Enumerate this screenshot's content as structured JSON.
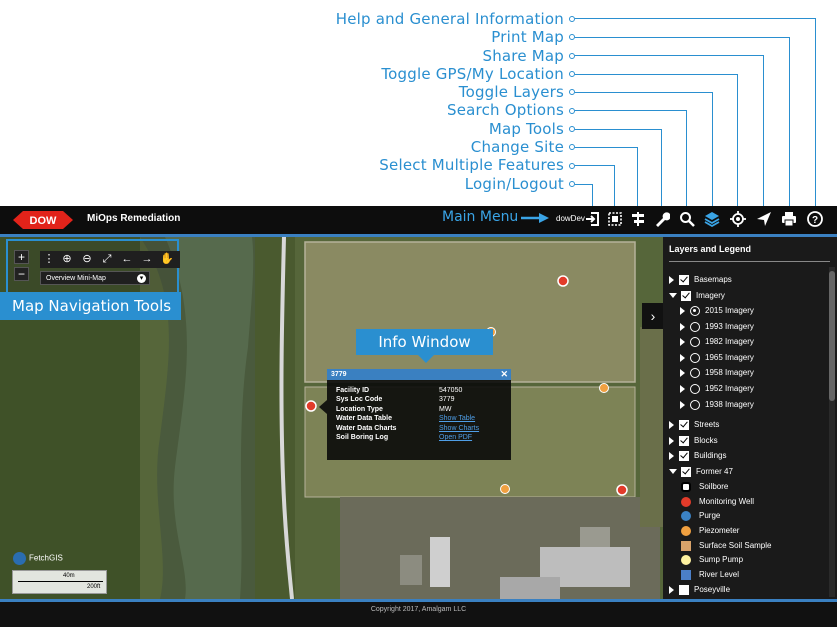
{
  "callouts": [
    {
      "label": "Help and General Information"
    },
    {
      "label": "Print Map"
    },
    {
      "label": "Share Map"
    },
    {
      "label": "Toggle GPS/My Location"
    },
    {
      "label": "Toggle Layers"
    },
    {
      "label": "Search Options"
    },
    {
      "label": "Map Tools"
    },
    {
      "label": "Change Site"
    },
    {
      "label": "Select Multiple Features"
    },
    {
      "label": "Login/Logout"
    }
  ],
  "header": {
    "logo_text": "DOW",
    "app_title": "MiOps Remediation",
    "main_menu_label": "Main Menu",
    "user": "dowDev",
    "tools": [
      "login-icon",
      "select-multiple-icon",
      "change-site-icon",
      "map-tools-icon",
      "search-icon",
      "layers-icon",
      "gps-icon",
      "share-icon",
      "print-icon",
      "help-icon"
    ]
  },
  "nav_tools": {
    "label": "Map Navigation Tools",
    "zoom_in": "+",
    "zoom_out": "−",
    "minimap_label": "Overview Mini-Map"
  },
  "info_window": {
    "label": "Info Window",
    "title": "3779",
    "rows": [
      {
        "key": "Facility ID",
        "value": "547050"
      },
      {
        "key": "Sys Loc Code",
        "value": "3779"
      },
      {
        "key": "Location Type",
        "value": "MW"
      },
      {
        "key": "Water Data Table",
        "value": "Show Table"
      },
      {
        "key": "Water Data Charts",
        "value": "Show Charts"
      },
      {
        "key": "Soil Boring Log",
        "value": "Open PDF"
      }
    ]
  },
  "map": {
    "attribution": "FetchGIS",
    "scale_top": "40m",
    "scale_bottom": "200ft"
  },
  "layers_panel": {
    "title": "Layers and Legend",
    "basemaps": "Basemaps",
    "imagery": "Imagery",
    "imagery_years": [
      "2015 Imagery",
      "1993 Imagery",
      "1982 Imagery",
      "1965 Imagery",
      "1958 Imagery",
      "1952 Imagery",
      "1938 Imagery"
    ],
    "streets": "Streets",
    "blocks": "Blocks",
    "buildings": "Buildings",
    "former": "Former 47",
    "legend": [
      {
        "label": "Soilbore",
        "color": "#ffffff"
      },
      {
        "label": "Monitoring Well",
        "color": "#e23b2a"
      },
      {
        "label": "Purge",
        "color": "#3b82c4"
      },
      {
        "label": "Piezometer",
        "color": "#f0a040"
      },
      {
        "label": "Surface Soil Sample",
        "color": "#d9a36a"
      },
      {
        "label": "Sump Pump",
        "color": "#fff2a0"
      },
      {
        "label": "River Level",
        "color": "#4b7fc7"
      }
    ],
    "poseyville": "Poseyville"
  },
  "footer": {
    "copyright": "Copyright 2017, Amalgam LLC"
  },
  "colors": {
    "accent": "#2a8fd0",
    "header": "#0d0d0d",
    "dow_red": "#e2231a"
  }
}
